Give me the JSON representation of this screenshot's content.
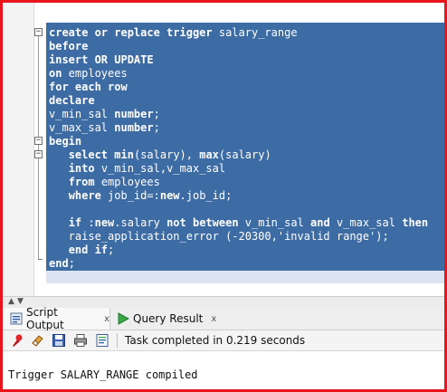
{
  "editor": {
    "lines": [
      [
        {
          "t": "create or replace trigger ",
          "kw": true
        },
        {
          "t": "salary_range",
          "kw": false
        }
      ],
      [
        {
          "t": "before",
          "kw": true
        }
      ],
      [
        {
          "t": "insert OR UPDATE",
          "kw": true
        }
      ],
      [
        {
          "t": "on",
          "kw": true
        },
        {
          "t": " employees",
          "kw": false
        }
      ],
      [
        {
          "t": "for each row",
          "kw": true
        }
      ],
      [
        {
          "t": "declare",
          "kw": true
        }
      ],
      [
        {
          "t": "v_min_sal ",
          "kw": false
        },
        {
          "t": "number",
          "kw": true
        },
        {
          "t": ";",
          "kw": false
        }
      ],
      [
        {
          "t": "v_max_sal ",
          "kw": false
        },
        {
          "t": "number",
          "kw": true
        },
        {
          "t": ";",
          "kw": false
        }
      ],
      [
        {
          "t": "begin",
          "kw": true
        }
      ],
      [
        {
          "t": "   ",
          "kw": false
        },
        {
          "t": "select",
          "kw": true
        },
        {
          "t": " ",
          "kw": false
        },
        {
          "t": "min",
          "kw": true
        },
        {
          "t": "(salary), ",
          "kw": false
        },
        {
          "t": "max",
          "kw": true
        },
        {
          "t": "(salary)",
          "kw": false
        }
      ],
      [
        {
          "t": "   ",
          "kw": false
        },
        {
          "t": "into",
          "kw": true
        },
        {
          "t": " v_min_sal,v_max_sal",
          "kw": false
        }
      ],
      [
        {
          "t": "   ",
          "kw": false
        },
        {
          "t": "from",
          "kw": true
        },
        {
          "t": " employees",
          "kw": false
        }
      ],
      [
        {
          "t": "   ",
          "kw": false
        },
        {
          "t": "where",
          "kw": true
        },
        {
          "t": " job_id=:",
          "kw": false
        },
        {
          "t": "new",
          "kw": true
        },
        {
          "t": ".job_id;",
          "kw": false
        }
      ],
      [],
      [
        {
          "t": "   ",
          "kw": false
        },
        {
          "t": "if",
          "kw": true
        },
        {
          "t": " :",
          "kw": false
        },
        {
          "t": "new",
          "kw": true
        },
        {
          "t": ".salary ",
          "kw": false
        },
        {
          "t": "not between",
          "kw": true
        },
        {
          "t": " v_min_sal ",
          "kw": false
        },
        {
          "t": "and",
          "kw": true
        },
        {
          "t": " v_max_sal ",
          "kw": false
        },
        {
          "t": "then",
          "kw": true
        }
      ],
      [
        {
          "t": "   raise_application_error (-20300,'invalid range');",
          "kw": false
        }
      ],
      [
        {
          "t": "   ",
          "kw": false
        },
        {
          "t": "end if",
          "kw": true
        },
        {
          "t": ";",
          "kw": false
        }
      ],
      [
        {
          "t": "end",
          "kw": true
        },
        {
          "t": ";",
          "kw": false
        }
      ]
    ]
  },
  "tabs": [
    {
      "label": "Script Output",
      "close": "x",
      "icon": "script-output-icon"
    },
    {
      "label": "Query Result",
      "close": "x",
      "icon": "query-result-play-icon"
    }
  ],
  "toolbar": {
    "icons": [
      "pin-icon",
      "eraser-icon",
      "save-icon",
      "print-icon",
      "script-file-icon"
    ],
    "status": "Task completed in 0.219 seconds"
  },
  "output": {
    "text": "Trigger SALARY_RANGE compiled"
  },
  "colors": {
    "frame": "#e8161c",
    "selection": "#3d6ba4",
    "play": "#39a845"
  }
}
